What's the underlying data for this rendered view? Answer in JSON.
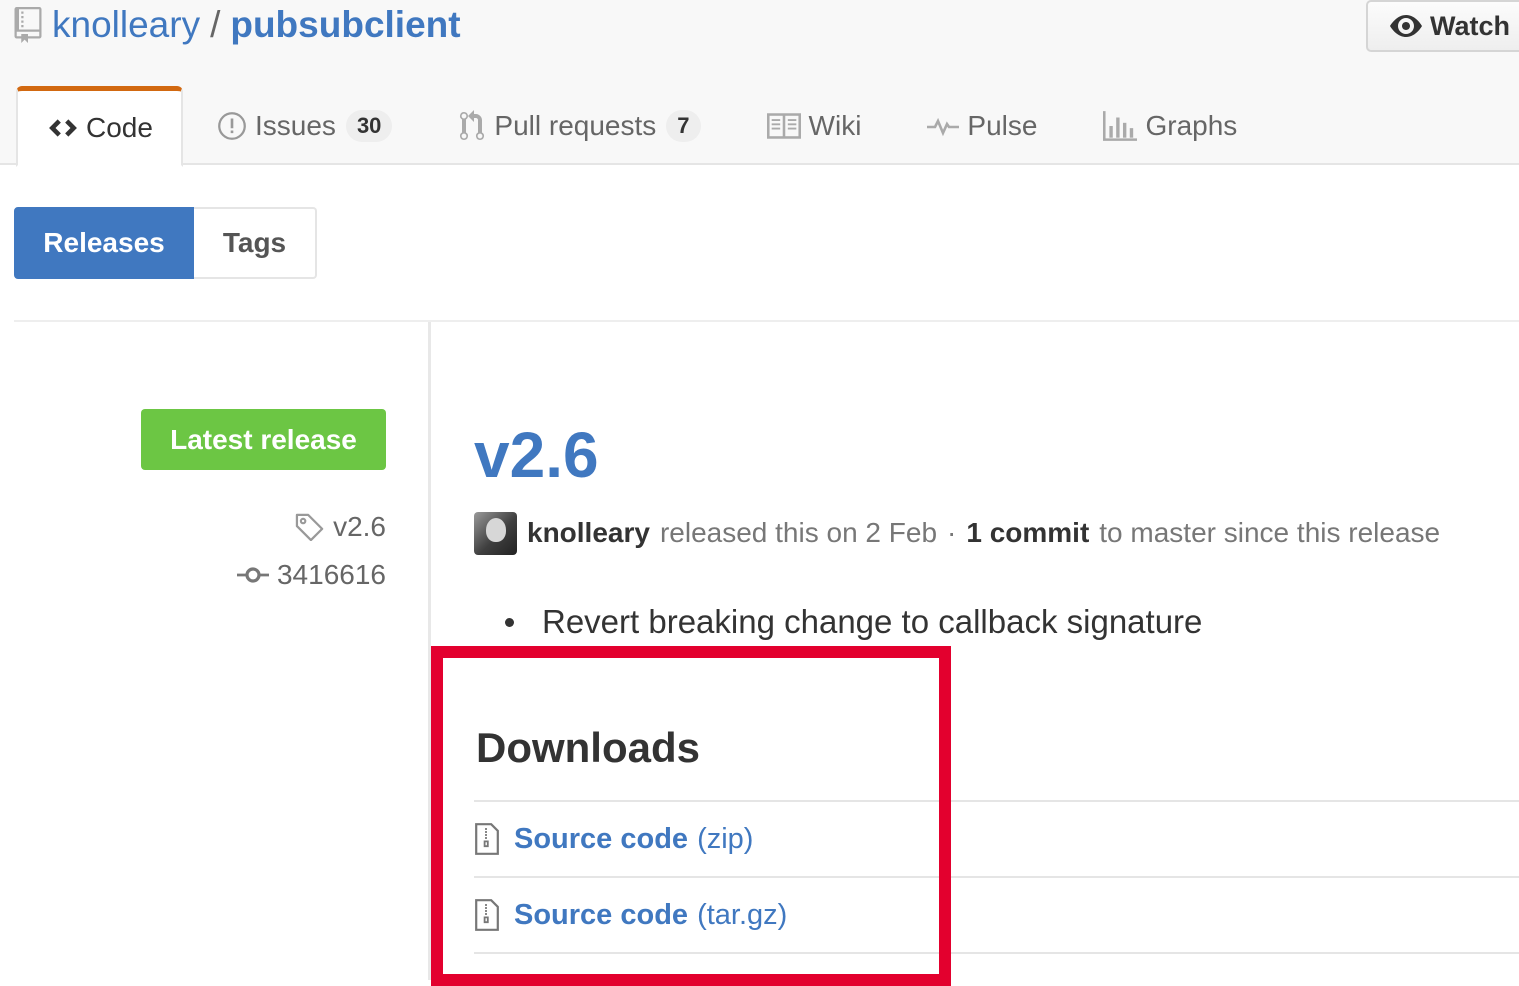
{
  "repo": {
    "owner": "knolleary",
    "separator": "/",
    "name": "pubsubclient"
  },
  "watch_button": {
    "label": "Watch",
    "icon": "eye-icon"
  },
  "reponav": {
    "tabs": [
      {
        "label": "Code",
        "icon": "code-icon",
        "selected": true
      },
      {
        "label": "Issues",
        "icon": "issue-opened-icon",
        "count": "30"
      },
      {
        "label": "Pull requests",
        "icon": "git-pull-request-icon",
        "count": "7"
      },
      {
        "label": "Wiki",
        "icon": "book-icon"
      },
      {
        "label": "Pulse",
        "icon": "pulse-icon"
      },
      {
        "label": "Graphs",
        "icon": "graph-icon"
      }
    ],
    "accent_color": "#d26911"
  },
  "subnav": {
    "releases_label": "Releases",
    "tags_label": "Tags",
    "selected_color": "#4078c0"
  },
  "release": {
    "badge": "Latest release",
    "badge_color": "#6cc644",
    "tag": "v2.6",
    "commit": "3416616",
    "title": "v2.6",
    "author": "knolleary",
    "released_text": "released this on 2 Feb",
    "separator": "·",
    "commit_count": "1 commit",
    "since_text": "to master since this release",
    "notes": [
      "Revert breaking change to callback signature"
    ]
  },
  "downloads": {
    "title": "Downloads",
    "items": [
      {
        "label": "Source code",
        "ext": "(zip)",
        "icon": "file-zip-icon"
      },
      {
        "label": "Source code",
        "ext": "(tar.gz)",
        "icon": "file-zip-icon"
      }
    ],
    "highlight_color": "#e3002e"
  }
}
